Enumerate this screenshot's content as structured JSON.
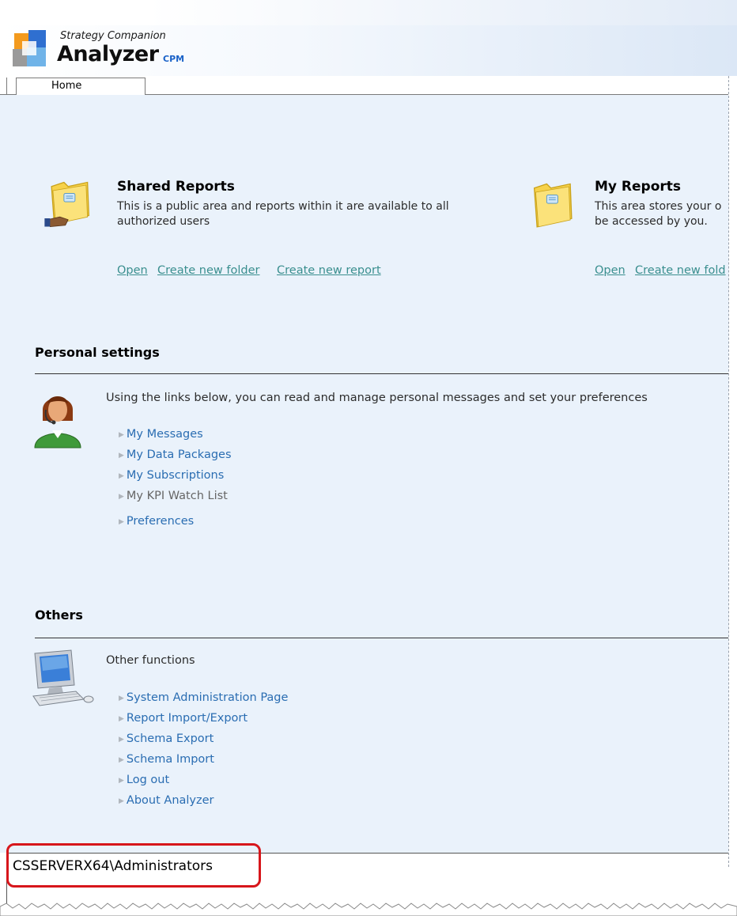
{
  "app": {
    "brand_sub": "Strategy Companion",
    "brand_main": "Analyzer",
    "brand_suffix": "CPM"
  },
  "tabs": [
    {
      "label": "Home",
      "selected": true
    }
  ],
  "shared_reports": {
    "title": "Shared Reports",
    "description": "This is a public area and reports within it are available to all authorized users",
    "links": [
      "Open",
      "Create new folder",
      "Create new report"
    ]
  },
  "my_reports": {
    "title": "My Reports",
    "description_line1": "This area stores your o",
    "description_line2": "be accessed by you.",
    "links": [
      "Open",
      "Create new fold"
    ]
  },
  "personal_settings": {
    "title": "Personal settings",
    "intro": "Using the links below, you can read and manage personal messages and set your preferences",
    "items": [
      {
        "label": "My Messages",
        "enabled": true
      },
      {
        "label": "My Data Packages",
        "enabled": true
      },
      {
        "label": "My Subscriptions",
        "enabled": true
      },
      {
        "label": "My KPI Watch List",
        "enabled": false
      },
      {
        "label": "Preferences",
        "enabled": true
      }
    ]
  },
  "others": {
    "title": "Others",
    "intro": "Other functions",
    "items": [
      {
        "label": "System Administration Page"
      },
      {
        "label": "Report Import/Export"
      },
      {
        "label": "Schema Export"
      },
      {
        "label": "Schema Import"
      },
      {
        "label": "Log out"
      },
      {
        "label": "About Analyzer"
      }
    ]
  },
  "footer": {
    "user": "CSSERVERX64\\Administrators"
  },
  "colors": {
    "content_bg": "#eaf2fb",
    "link": "#2a6db2",
    "action_link": "#3a8f8f",
    "highlight": "#d7161b"
  }
}
